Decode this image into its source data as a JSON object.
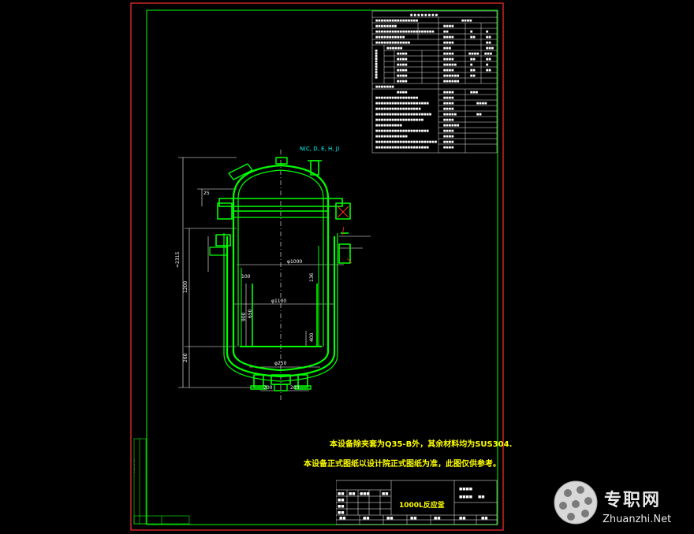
{
  "drawing": {
    "title": "1000L反应釜",
    "note_line1": "本设备除夹套为Q35-B外，其余材料均为SUS304.",
    "note_line2": "本设备正式图纸以设计院正式图纸为准，此图仅供参考。",
    "nozzle_label": "N(C, D, E, H, J)",
    "dims": {
      "inner_dia": "φ1000",
      "jacket_dia": "φ1100",
      "bottom_dia": "φ250",
      "total_height": "≈2315",
      "d1200": "1200",
      "d260": "260",
      "d200a": "200",
      "d200b": "200",
      "d900": "900",
      "d650": "650",
      "d400": "400",
      "d136": "136",
      "d25": "25",
      "d100": "100"
    }
  },
  "watermark": {
    "brand": "专职网",
    "url": "Zhuanzhi.Net"
  },
  "colors": {
    "frame": "#ff0000",
    "border": "#00ff00",
    "vessel": "#00ff00",
    "dim": "#ffffff",
    "note": "#ffff00"
  }
}
